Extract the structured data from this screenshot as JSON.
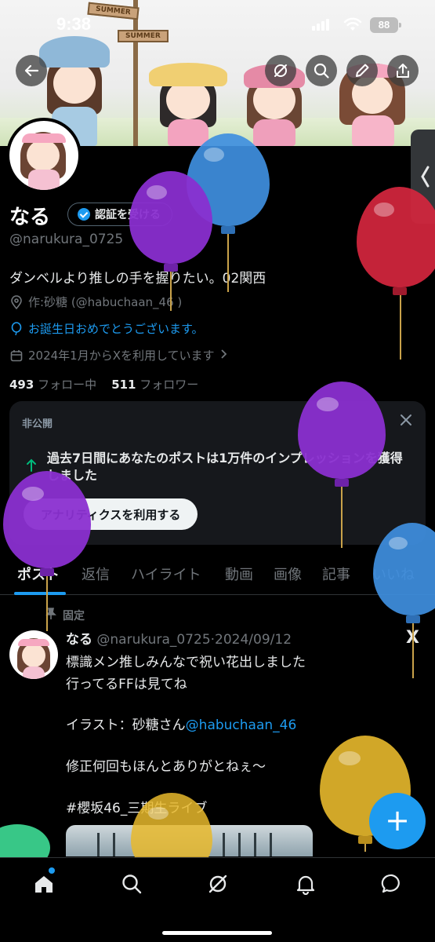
{
  "status_bar": {
    "time": "9:38",
    "battery": "88"
  },
  "banner": {
    "sign_top": "SUMMER",
    "sign_mid": "SUMMER"
  },
  "profile": {
    "name": "なる",
    "verify_label": "認証を受ける",
    "handle": "@narukura_0725",
    "bio": "ダンベルより推しの手を握りたい。02関西",
    "location": "作:砂糖 (@habuchaan_46 )",
    "birthday": "お誕生日おめでとうございます。",
    "joined": "2024年1月からXを利用しています",
    "following_count": "493",
    "following_label": "フォロー中",
    "followers_count": "511",
    "followers_label": "フォロワー"
  },
  "private_card": {
    "label": "非公開",
    "text": "過去7日間にあなたのポストは1万件のインプレッションを獲得しました",
    "button": "アナリティクスを利用する"
  },
  "tabs": [
    "ポスト",
    "返信",
    "ハイライト",
    "動画",
    "画像",
    "記事",
    "いいね"
  ],
  "post": {
    "pinned_label": "固定",
    "author": "なる",
    "handle_date": "@narukura_0725·2024/09/12",
    "line1": "標識メン推しみんなで祝い花出しました",
    "line2": "行ってるFFは見てね",
    "line3_prefix": "イラスト：砂糖さん",
    "line3_mention": "@habuchaan_46",
    "line4": "修正何回もほんとありがとねぇ〜",
    "hashtag": "#櫻坂46_三期生ライブ"
  },
  "fab_label": "+",
  "icons": {
    "back": "back-arrow-icon",
    "grok": "grok-icon",
    "search": "search-icon",
    "edit": "pencil-icon",
    "share": "share-icon",
    "home": "home-icon",
    "notifications": "bell-icon",
    "messages": "chat-icon"
  },
  "colors": {
    "accent": "#1d9bf0",
    "background": "#000000",
    "muted": "#71767b"
  }
}
